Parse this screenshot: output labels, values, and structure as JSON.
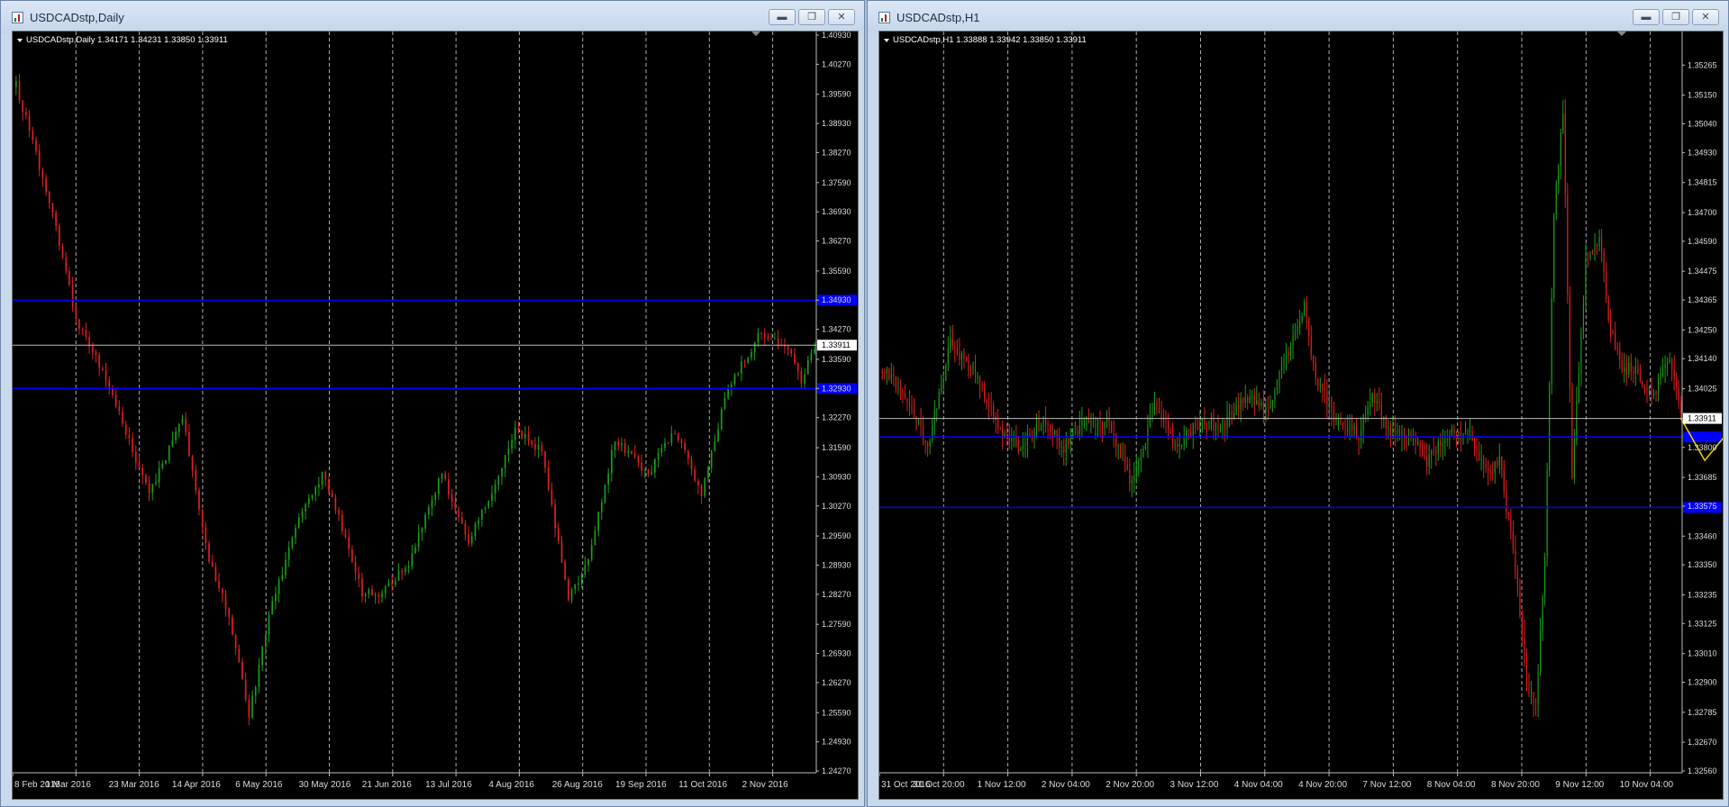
{
  "windows": [
    {
      "title": "USDCADstp,Daily",
      "info": {
        "symbol": "USDCADstp,Daily",
        "ohlc": "1.34171 1.34231 1.33850 1.33911"
      },
      "buttons": [
        "minimize",
        "restore",
        "close"
      ],
      "colors": {
        "bull": "#1aa01a",
        "bear": "#e02020",
        "level": "#0000ff",
        "price_line": "#bbbbbb",
        "grid": "#cccccc"
      },
      "price_marker": "1.33911",
      "chart_data": {
        "type": "candlestick",
        "title": "USDCADstp,Daily",
        "ylim": [
          1.2427,
          1.4093
        ],
        "y_ticks": [
          "1.40930",
          "1.40270",
          "1.39590",
          "1.38930",
          "1.38270",
          "1.37590",
          "1.36930",
          "1.36270",
          "1.35590",
          "1.34930",
          "1.34270",
          "1.33590",
          "1.32930",
          "1.32270",
          "1.31590",
          "1.30930",
          "1.30270",
          "1.29590",
          "1.28930",
          "1.28270",
          "1.27590",
          "1.26930",
          "1.26270",
          "1.25590",
          "1.24930",
          "1.24270"
        ],
        "x_labels": [
          "8 Feb 2016",
          "1 Mar 2016",
          "23 Mar 2016",
          "14 Apr 2016",
          "6 May 2016",
          "30 May 2016",
          "21 Jun 2016",
          "13 Jul 2016",
          "4 Aug 2016",
          "26 Aug 2016",
          "19 Sep 2016",
          "11 Oct 2016",
          "2 Nov 2016"
        ],
        "levels": [
          1.3493,
          1.3293
        ],
        "current_price": 1.33911,
        "anchors": [
          [
            0,
            1.398
          ],
          [
            10,
            1.372
          ],
          [
            18,
            1.345
          ],
          [
            28,
            1.33
          ],
          [
            40,
            1.305
          ],
          [
            50,
            1.323
          ],
          [
            58,
            1.29
          ],
          [
            64,
            1.278
          ],
          [
            70,
            1.255
          ],
          [
            76,
            1.278
          ],
          [
            84,
            1.298
          ],
          [
            92,
            1.31
          ],
          [
            98,
            1.298
          ],
          [
            104,
            1.283
          ],
          [
            110,
            1.283
          ],
          [
            118,
            1.29
          ],
          [
            128,
            1.31
          ],
          [
            136,
            1.295
          ],
          [
            144,
            1.308
          ],
          [
            150,
            1.32
          ],
          [
            158,
            1.315
          ],
          [
            166,
            1.282
          ],
          [
            172,
            1.29
          ],
          [
            180,
            1.318
          ],
          [
            190,
            1.31
          ],
          [
            198,
            1.32
          ],
          [
            206,
            1.305
          ],
          [
            214,
            1.33
          ],
          [
            224,
            1.342
          ],
          [
            232,
            1.338
          ],
          [
            236,
            1.331
          ],
          [
            240,
            1.339
          ]
        ],
        "seed": 7
      }
    },
    {
      "title": "USDCADstp,H1",
      "info": {
        "symbol": "USDCADstp,H1",
        "ohlc": "1.33888 1.33942 1.33850 1.33911"
      },
      "buttons": [
        "minimize",
        "restore",
        "close"
      ],
      "colors": {
        "bull": "#1aa01a",
        "bear": "#e02020",
        "level": "#0000ff",
        "price_line": "#bbbbbb",
        "grid": "#cccccc",
        "projection": "#f0d000"
      },
      "price_marker": "1.33911",
      "chart_data": {
        "type": "candlestick",
        "title": "USDCADstp,H1",
        "ylim": [
          1.3256,
          1.3538
        ],
        "y_ticks": [
          "1.35265",
          "1.35150",
          "1.35040",
          "1.34930",
          "1.34815",
          "1.34700",
          "1.34590",
          "1.34475",
          "1.34365",
          "1.34250",
          "1.34140",
          "1.34025",
          "1.33911",
          "1.33800",
          "1.33685",
          "1.33575",
          "1.33460",
          "1.33350",
          "1.33235",
          "1.33125",
          "1.33010",
          "1.32900",
          "1.32785",
          "1.32670",
          "1.32560"
        ],
        "x_labels": [
          "31 Oct 2016",
          "31 Oct 20:00",
          "1 Nov 12:00",
          "2 Nov 04:00",
          "2 Nov 20:00",
          "3 Nov 12:00",
          "4 Nov 04:00",
          "4 Nov 20:00",
          "7 Nov 12:00",
          "8 Nov 04:00",
          "8 Nov 20:00",
          "9 Nov 12:00",
          "10 Nov 04:00"
        ],
        "levels": [
          1.3384,
          1.3357
        ],
        "current_price": 1.33911,
        "anchors": [
          [
            0,
            1.341
          ],
          [
            10,
            1.34
          ],
          [
            20,
            1.338
          ],
          [
            30,
            1.342
          ],
          [
            40,
            1.341
          ],
          [
            50,
            1.339
          ],
          [
            60,
            1.338
          ],
          [
            70,
            1.339
          ],
          [
            80,
            1.338
          ],
          [
            90,
            1.339
          ],
          [
            100,
            1.339
          ],
          [
            110,
            1.3365
          ],
          [
            120,
            1.3395
          ],
          [
            130,
            1.338
          ],
          [
            140,
            1.339
          ],
          [
            150,
            1.3388
          ],
          [
            160,
            1.34
          ],
          [
            170,
            1.3395
          ],
          [
            180,
            1.342
          ],
          [
            186,
            1.3435
          ],
          [
            190,
            1.341
          ],
          [
            200,
            1.339
          ],
          [
            210,
            1.3385
          ],
          [
            216,
            1.34
          ],
          [
            224,
            1.3385
          ],
          [
            232,
            1.3385
          ],
          [
            240,
            1.3375
          ],
          [
            250,
            1.3385
          ],
          [
            260,
            1.3385
          ],
          [
            266,
            1.337
          ],
          [
            272,
            1.3375
          ],
          [
            278,
            1.334
          ],
          [
            284,
            1.329
          ],
          [
            288,
            1.328
          ],
          [
            292,
            1.334
          ],
          [
            296,
            1.347
          ],
          [
            300,
            1.351
          ],
          [
            304,
            1.337
          ],
          [
            310,
            1.345
          ],
          [
            316,
            1.346
          ],
          [
            320,
            1.343
          ],
          [
            326,
            1.341
          ],
          [
            332,
            1.341
          ],
          [
            340,
            1.34
          ],
          [
            346,
            1.3415
          ],
          [
            352,
            1.3395
          ]
        ],
        "projection": [
          [
            1.33911,
            0
          ],
          [
            1.3375,
            11
          ],
          [
            1.3385,
            21
          ],
          [
            1.3363,
            34
          ]
        ],
        "seed": 21
      }
    }
  ]
}
